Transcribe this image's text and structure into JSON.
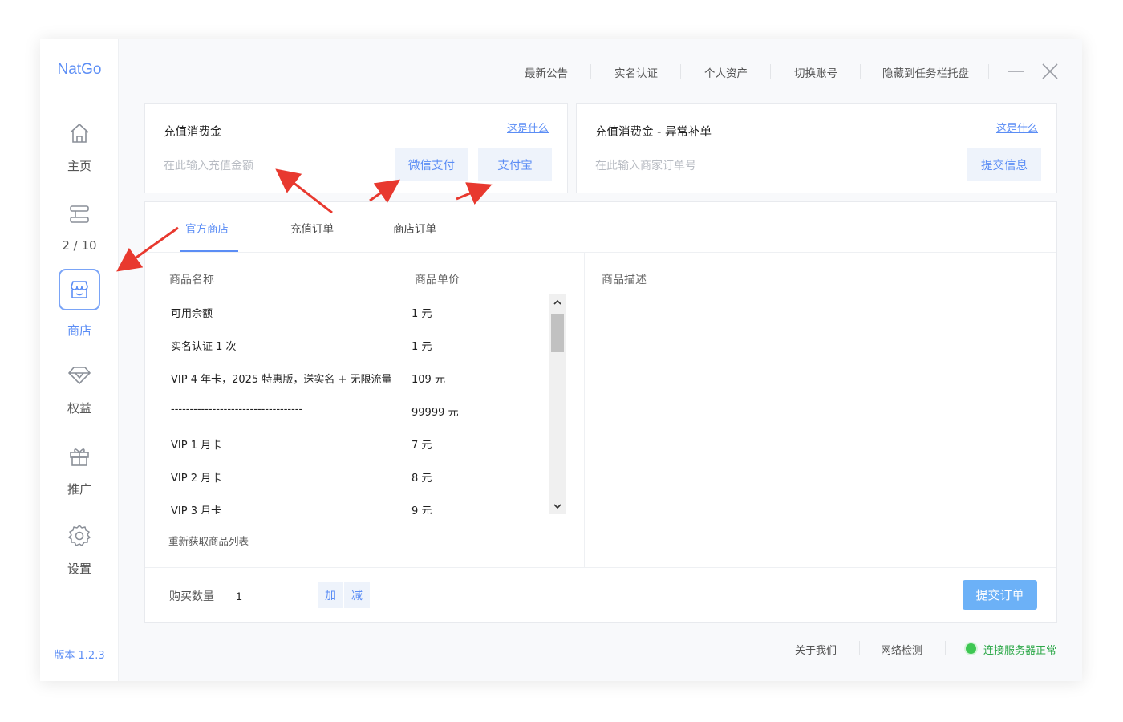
{
  "app": {
    "brand": "NatGo",
    "version": "版本 1.2.3"
  },
  "sidebar": {
    "items": [
      {
        "label": "主页",
        "icon": "home-icon"
      },
      {
        "label": "2 / 10",
        "icon": "server-icon"
      },
      {
        "label": "商店",
        "icon": "shop-icon",
        "active": true
      },
      {
        "label": "权益",
        "icon": "diamond-icon"
      },
      {
        "label": "推广",
        "icon": "gift-icon"
      },
      {
        "label": "设置",
        "icon": "gear-icon"
      }
    ]
  },
  "topbar": {
    "links": [
      "最新公告",
      "实名认证",
      "个人资产",
      "切换账号",
      "隐藏到任务栏托盘"
    ],
    "minimize_icon": "minimize-icon",
    "close_icon": "close-icon"
  },
  "recharge": {
    "title": "充值消费金",
    "help": "这是什么",
    "placeholder": "在此输入充值金额",
    "wechat_label": "微信支付",
    "alipay_label": "支付宝"
  },
  "makeup": {
    "title": "充值消费金 - 异常补单",
    "help": "这是什么",
    "placeholder": "在此输入商家订单号",
    "submit_label": "提交信息"
  },
  "tabs": [
    "官方商店",
    "充值订单",
    "商店订单"
  ],
  "active_tab": 0,
  "table": {
    "headers": {
      "name": "商品名称",
      "price": "商品单价",
      "description": "商品描述"
    },
    "rows": [
      {
        "name": "可用余额",
        "price": "1 元"
      },
      {
        "name": "实名认证 1 次",
        "price": "1 元"
      },
      {
        "name": "VIP 4 年卡，2025 特惠版，送实名 + 无限流量",
        "price": "109 元"
      },
      {
        "name": "-----------------------------------",
        "price": "99999 元"
      },
      {
        "name": "VIP 1 月卡",
        "price": "7 元"
      },
      {
        "name": "VIP 2 月卡",
        "price": "8 元"
      },
      {
        "name": "VIP 3 月卡",
        "price": "9 元"
      }
    ],
    "refresh_label": "重新获取商品列表"
  },
  "purchase": {
    "qty_label": "购买数量",
    "qty_value": "1",
    "add_label": "加",
    "sub_label": "减",
    "submit_label": "提交订单"
  },
  "footer": {
    "about": "关于我们",
    "network": "网络检测",
    "status": "连接服务器正常",
    "status_color": "#3ec752"
  },
  "colors": {
    "accent": "#5b8df5",
    "annotation": "#e8392f"
  }
}
